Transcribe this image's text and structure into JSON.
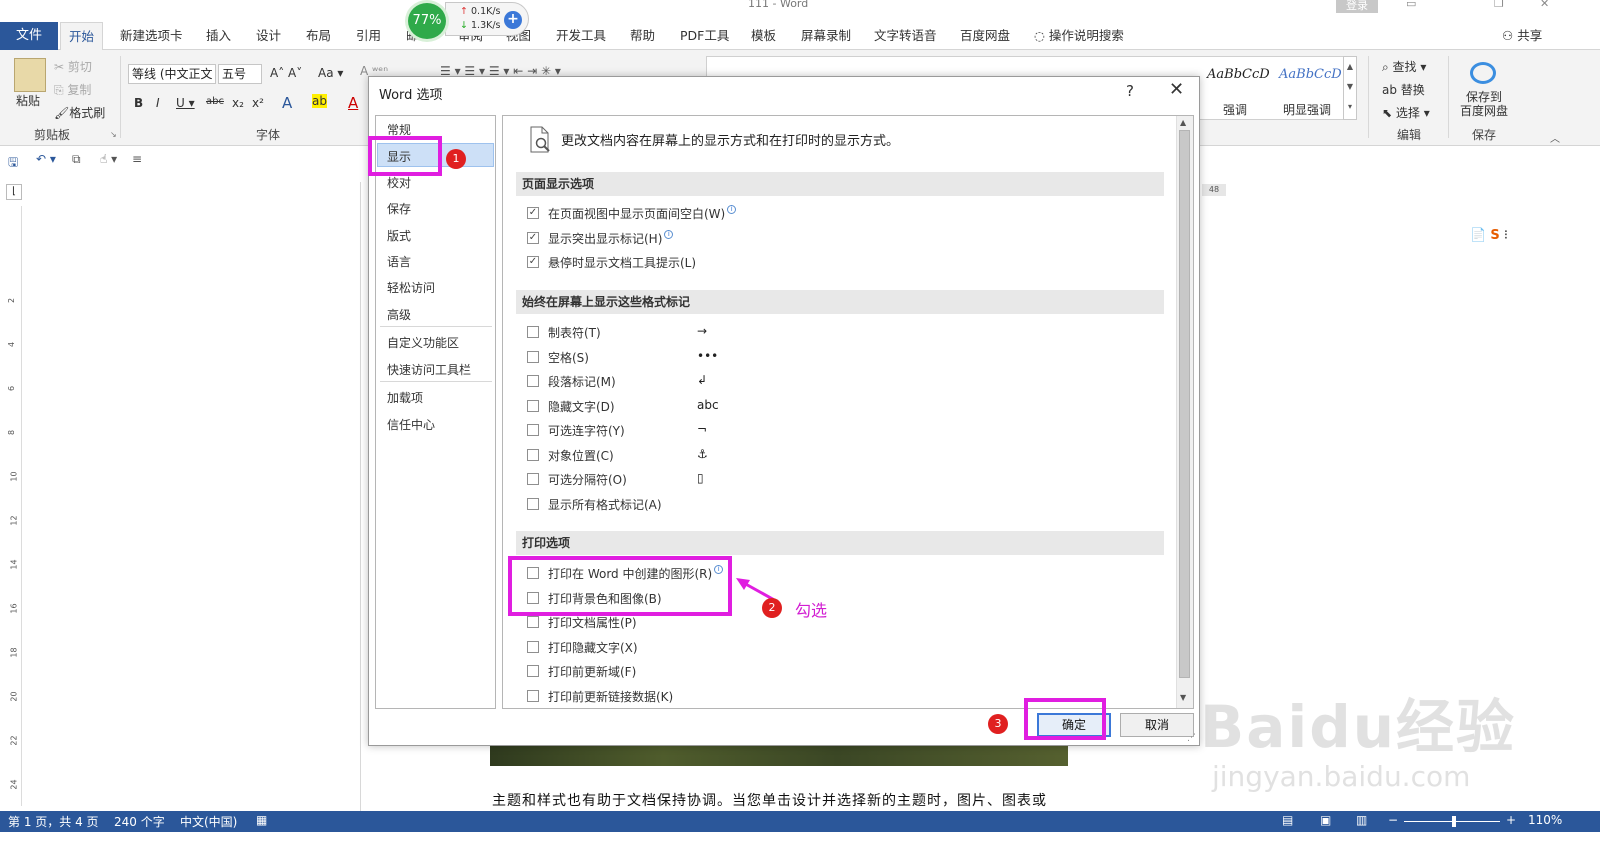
{
  "titlebar": {
    "title": "111  -  Word",
    "login": "登录"
  },
  "tabs": {
    "file": "文件",
    "items": [
      "开始",
      "新建选项卡",
      "插入",
      "设计",
      "布局",
      "引用",
      "邮",
      "审阅",
      "视图",
      "开发工具",
      "帮助",
      "PDF工具",
      "模板",
      "屏幕录制",
      "文字转语音",
      "百度网盘"
    ],
    "search": "操作说明搜索",
    "share": "共享"
  },
  "speed": {
    "percent": "77%",
    "up": "0.1K/s",
    "down": "1.3K/s"
  },
  "ribbon": {
    "paste": "粘贴",
    "cut": "剪切",
    "copy": "复制",
    "format_painter": "格式刷",
    "clipboard_label": "剪贴板",
    "font_name": "等线 (中文正文",
    "font_size": "五号",
    "font_label": "字体",
    "styles": [
      {
        "preview": "AaBbCcD",
        "label": "强调"
      },
      {
        "preview": "AaBbCcD",
        "label": "明显强调"
      }
    ],
    "find": "查找",
    "replace": "替换",
    "select": "选择",
    "edit_label": "编辑",
    "save_baidu": "保存到\n百度网盘",
    "save_label": "保存"
  },
  "dialog": {
    "title": "Word 选项",
    "help": "?",
    "nav": [
      "常规",
      "显示",
      "校对",
      "保存",
      "版式",
      "语言",
      "轻松访问",
      "高级",
      "自定义功能区",
      "快速访问工具栏",
      "加载项",
      "信任中心"
    ],
    "nav_selected": "显示",
    "intro": "更改文档内容在屏幕上的显示方式和在打印时的显示方式。",
    "sections": {
      "page_display": "页面显示选项",
      "format_marks": "始终在屏幕上显示这些格式标记",
      "print": "打印选项"
    },
    "page_display_options": [
      {
        "label": "在页面视图中显示页面间空白(W)",
        "checked": true,
        "info": true
      },
      {
        "label": "显示突出显示标记(H)",
        "checked": true,
        "info": true
      },
      {
        "label": "悬停时显示文档工具提示(L)",
        "checked": true,
        "info": false
      }
    ],
    "format_mark_options": [
      {
        "label": "制表符(T)",
        "mark": "→"
      },
      {
        "label": "空格(S)",
        "mark": "•••"
      },
      {
        "label": "段落标记(M)",
        "mark": "↲"
      },
      {
        "label": "隐藏文字(D)",
        "mark": "abc"
      },
      {
        "label": "可选连字符(Y)",
        "mark": "¬"
      },
      {
        "label": "对象位置(C)",
        "mark": "⚓"
      },
      {
        "label": "可选分隔符(O)",
        "mark": "▯"
      },
      {
        "label": "显示所有格式标记(A)",
        "mark": ""
      }
    ],
    "print_options": [
      {
        "label": "打印在 Word 中创建的图形(R)",
        "info": true
      },
      {
        "label": "打印背景色和图像(B)",
        "info": false
      },
      {
        "label": "打印文档属性(P)",
        "info": false
      },
      {
        "label": "打印隐藏文字(X)",
        "info": false
      },
      {
        "label": "打印前更新域(F)",
        "info": false
      },
      {
        "label": "打印前更新链接数据(K)",
        "info": false
      }
    ],
    "ok": "确定",
    "cancel": "取消"
  },
  "annotations": {
    "badge1": "1",
    "badge2": "2",
    "badge3": "3",
    "note": "勾选"
  },
  "document": {
    "text": "主题和样式也有助于文档保持协调。当您单击设计并选择新的主题时，图片、图表或",
    "ruler_mark": "48"
  },
  "statusbar": {
    "page": "第 1 页，共 4 页",
    "words": "240 个字",
    "lang": "中文(中国)",
    "zoom": "110%"
  },
  "watermark": {
    "brand": "Baidu经验",
    "url": "jingyan.baidu.com"
  }
}
